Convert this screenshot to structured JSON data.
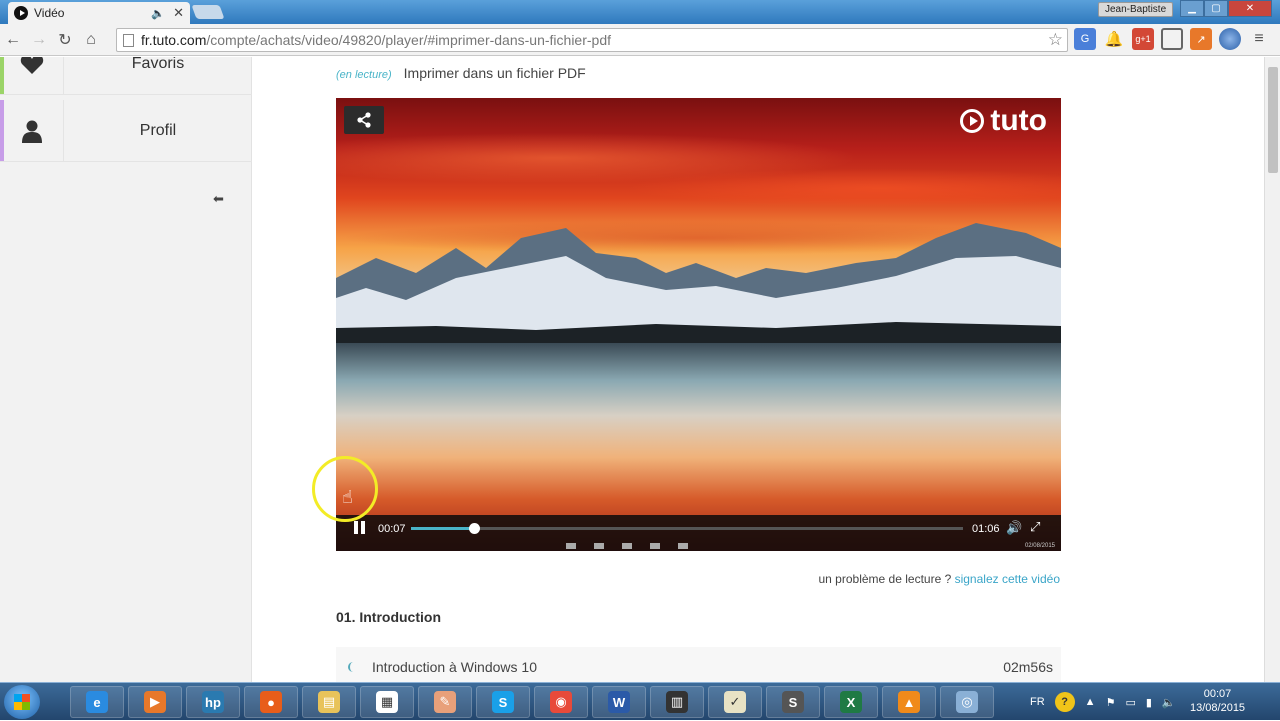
{
  "browser": {
    "tab_title": "Vidéo",
    "tab_audio": "🔈",
    "tab_close": "✕",
    "user_name": "Jean-Baptiste",
    "url_host": "fr.tuto.com",
    "url_rest": "/compte/achats/video/49820/player/#imprimer-dans-un-fichier-pdf"
  },
  "sidebar": {
    "items": [
      {
        "label": "Favoris",
        "icon": "heart-icon",
        "accent": "#9bd468"
      },
      {
        "label": "Profil",
        "icon": "user-icon",
        "accent": "#c79de8"
      }
    ],
    "collapse_icon": "arrow-left-icon"
  },
  "player": {
    "status": "(en lecture)",
    "title": "Imprimer dans un fichier PDF",
    "logo_text": "tuto",
    "time_current": "00:07",
    "time_total": "01:06",
    "progress": 0.115,
    "accent": "#4ab4c8",
    "datestamp": "02/08/2015"
  },
  "report": {
    "prefix": "un problème de lecture ?",
    "link": "signalez cette vidéo"
  },
  "chapter": {
    "title": "01. Introduction",
    "lessons": [
      {
        "name": "Introduction à Windows 10",
        "duration": "02m56s"
      }
    ]
  },
  "taskbar": {
    "apps": [
      "internet-explorer",
      "media-player",
      "hp",
      "firefox",
      "explorer",
      "app-grid",
      "paint",
      "skype",
      "chrome",
      "word",
      "video-editor",
      "notepad",
      "s-app",
      "excel",
      "vlc",
      "disc-app"
    ],
    "lang": "FR",
    "time": "00:07",
    "date": "13/08/2015"
  }
}
